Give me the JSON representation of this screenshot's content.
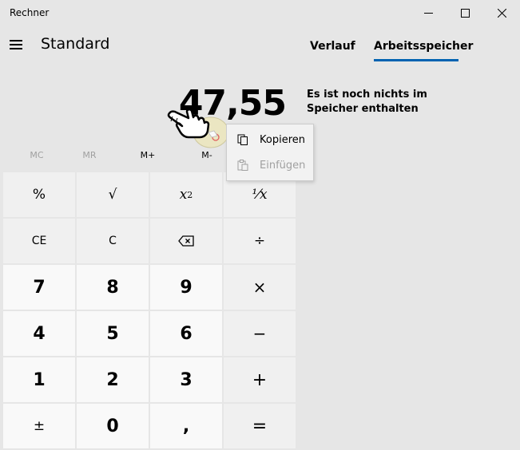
{
  "window": {
    "title": "Rechner"
  },
  "header": {
    "mode": "Standard"
  },
  "display": {
    "value": "47,55"
  },
  "memory_buttons": [
    {
      "label": "MC",
      "enabled": false
    },
    {
      "label": "MR",
      "enabled": false
    },
    {
      "label": "M+",
      "enabled": true
    },
    {
      "label": "M-",
      "enabled": true
    }
  ],
  "keys": {
    "percent": "%",
    "sqrt": "√",
    "square": "x",
    "square_exp": "2",
    "reciprocal": "⅟x",
    "ce": "CE",
    "c": "C",
    "divide": "÷",
    "seven": "7",
    "eight": "8",
    "nine": "9",
    "multiply": "×",
    "four": "4",
    "five": "5",
    "six": "6",
    "minus": "−",
    "one": "1",
    "two": "2",
    "three": "3",
    "plus": "+",
    "negate": "±",
    "zero": "0",
    "decimal": ",",
    "equals": "="
  },
  "tabs": {
    "history": "Verlauf",
    "memory": "Arbeitsspeicher"
  },
  "memory_panel": {
    "empty_message": "Es ist noch nichts im Speicher enthalten"
  },
  "context_menu": {
    "copy": "Kopieren",
    "paste": "Einfügen"
  },
  "colors": {
    "accent": "#0063b1",
    "background": "#e6e6e6",
    "fn_key": "#f0f0f0",
    "num_key": "#f9f9f9"
  }
}
